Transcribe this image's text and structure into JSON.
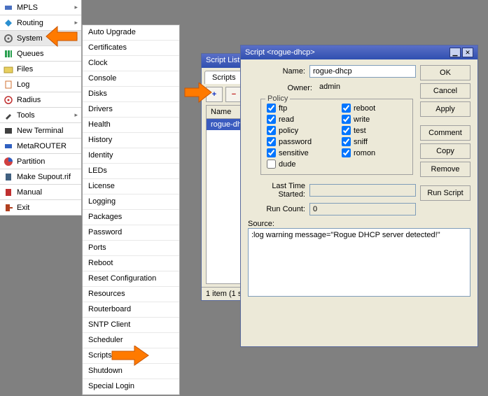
{
  "sidebar": {
    "items": [
      {
        "label": "MPLS",
        "icon": "#4a70c0"
      },
      {
        "label": "Routing",
        "icon": "#2a8fd0"
      },
      {
        "label": "System",
        "icon": "#666666"
      },
      {
        "label": "Queues",
        "icon": "#2aa050"
      },
      {
        "label": "Files",
        "icon": "#e8cf60"
      },
      {
        "label": "Log",
        "icon": "#d07030"
      },
      {
        "label": "Radius",
        "icon": "#c03030"
      },
      {
        "label": "Tools",
        "icon": "#444444"
      },
      {
        "label": "New Terminal",
        "icon": "#404040"
      },
      {
        "label": "MetaROUTER",
        "icon": "#3060c0"
      },
      {
        "label": "Partition",
        "icon": "#d04040"
      },
      {
        "label": "Make Supout.rif",
        "icon": "#406080"
      },
      {
        "label": "Manual",
        "icon": "#c03030"
      },
      {
        "label": "Exit",
        "icon": "#b04020"
      }
    ]
  },
  "submenu": {
    "items": [
      "Auto Upgrade",
      "Certificates",
      "Clock",
      "Console",
      "Disks",
      "Drivers",
      "Health",
      "History",
      "Identity",
      "LEDs",
      "License",
      "Logging",
      "Packages",
      "Password",
      "Ports",
      "Reboot",
      "Reset Configuration",
      "Resources",
      "Routerboard",
      "SNTP Client",
      "Scheduler",
      "Scripts",
      "Shutdown",
      "Special Login"
    ]
  },
  "scriptlist": {
    "title": "Script List",
    "tab": "Scripts",
    "add_glyph": "+",
    "remove_glyph": "−",
    "col_name": "Name",
    "row0": "rogue-dh",
    "status": "1 item (1 se"
  },
  "editor": {
    "title": "Script <rogue-dhcp>",
    "name_label": "Name:",
    "name_value": "rogue-dhcp",
    "owner_label": "Owner:",
    "owner_value": "admin",
    "policy_legend": "Policy",
    "policies": {
      "ftp": {
        "label": "ftp",
        "checked": true
      },
      "reboot": {
        "label": "reboot",
        "checked": true
      },
      "read": {
        "label": "read",
        "checked": true
      },
      "write": {
        "label": "write",
        "checked": true
      },
      "policy": {
        "label": "policy",
        "checked": true
      },
      "test": {
        "label": "test",
        "checked": true
      },
      "password": {
        "label": "password",
        "checked": true
      },
      "sniff": {
        "label": "sniff",
        "checked": true
      },
      "sensitive": {
        "label": "sensitive",
        "checked": true
      },
      "romon": {
        "label": "romon",
        "checked": true
      },
      "dude": {
        "label": "dude",
        "checked": false
      }
    },
    "last_time_label": "Last Time Started:",
    "last_time_value": "",
    "run_count_label": "Run Count:",
    "run_count_value": "0",
    "source_label": "Source:",
    "source_value": ":log warning message=\"Rogue DHCP server detected!\"",
    "buttons": {
      "ok": "OK",
      "cancel": "Cancel",
      "apply": "Apply",
      "comment": "Comment",
      "copy": "Copy",
      "remove": "Remove",
      "run": "Run Script"
    }
  }
}
